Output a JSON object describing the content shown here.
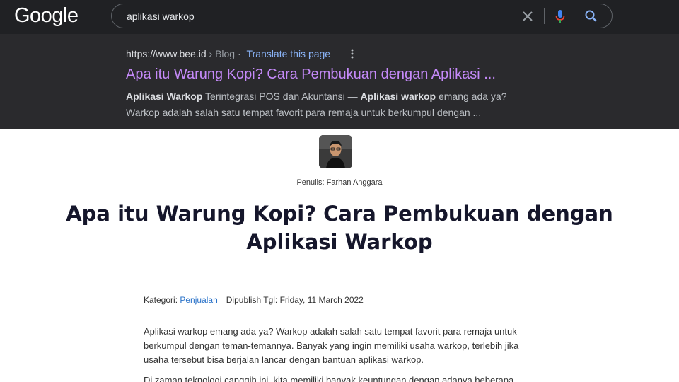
{
  "google": {
    "logo": "Google",
    "query": "aplikasi warkop",
    "icons": {
      "clear": "close-icon",
      "voice": "microphone-icon",
      "search": "search-icon",
      "more": "more-vert-icon"
    },
    "result": {
      "url": "https://www.bee.id",
      "breadcrumb": " › Blog",
      "dot": " · ",
      "translate": "Translate this page",
      "title": "Apa itu Warung Kopi? Cara Pembukuan dengan Aplikasi ...",
      "snippet_b1": "Aplikasi Warkop",
      "snippet_t1": " Terintegrasi POS dan Akuntansi — ",
      "snippet_b2": "Aplikasi warkop",
      "snippet_t2": " emang ada ya?",
      "snippet_line2": "Warkop adalah salah satu tempat favorit para remaja untuk berkumpul dengan ..."
    },
    "colors": {
      "background": "#202124",
      "result_bg": "#2a2a2d",
      "link_visited": "#c58af9",
      "link_blue": "#8ab4f8"
    }
  },
  "article": {
    "author": "Penulis: Farhan Anggara",
    "title_line1": "Apa itu Warung Kopi? Cara Pembukuan dengan",
    "title_line2": "Aplikasi Warkop",
    "category_label": "Kategori: ",
    "category_link": "Penjualan",
    "published": "Dipublish Tgl: Friday, 11 March 2022",
    "paragraph1": "Aplikasi warkop emang ada ya? Warkop adalah salah satu tempat favorit para remaja untuk berkumpul dengan teman-temannya. Banyak yang ingin memiliki usaha warkop, terlebih jika usaha tersebut bisa berjalan lancar dengan bantuan aplikasi warkop.",
    "paragraph2": "Di zaman teknologi canggih ini, kita memiliki banyak keuntungan dengan adanya beberapa",
    "colors": {
      "title": "#15162b",
      "link": "#2a72c8"
    }
  }
}
